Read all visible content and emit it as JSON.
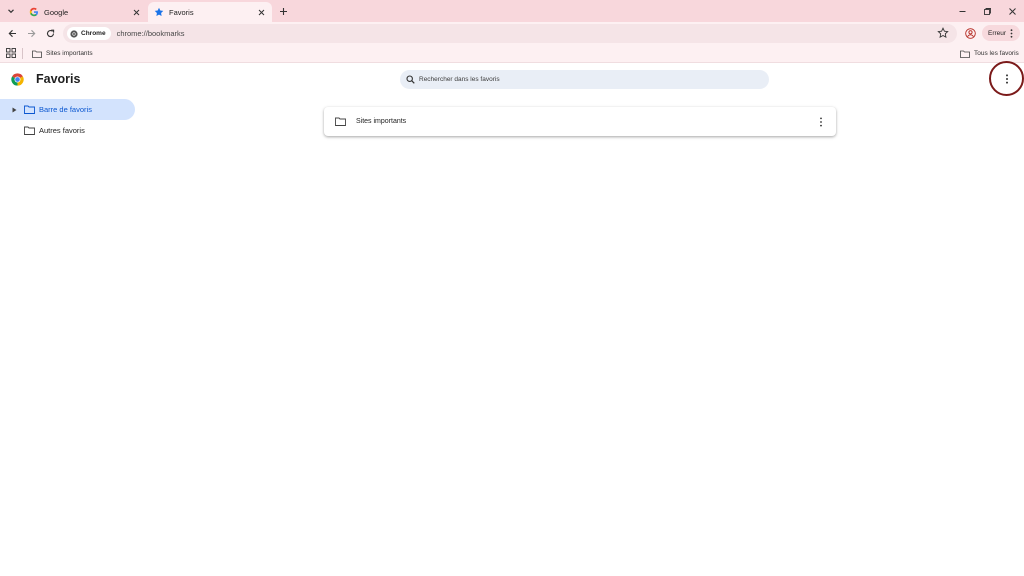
{
  "tabs": [
    {
      "title": "Google",
      "favicon": "google-g-icon",
      "active": false
    },
    {
      "title": "Favoris",
      "favicon": "star-icon",
      "active": true
    }
  ],
  "toolbar": {
    "chip_label": "Chrome",
    "url": "chrome://bookmarks",
    "error_label": "Erreur"
  },
  "bookmark_bar": {
    "items": [
      {
        "label": "Sites importants"
      }
    ],
    "all_bookmarks_label": "Tous les favoris"
  },
  "page": {
    "title": "Favoris",
    "search_placeholder": "Rechercher dans les favoris"
  },
  "sidebar": {
    "items": [
      {
        "label": "Barre de favoris",
        "selected": true
      },
      {
        "label": "Autres favoris",
        "selected": false
      }
    ]
  },
  "content": {
    "folders": [
      {
        "label": "Sites importants"
      }
    ]
  },
  "colors": {
    "tabstrip_bg": "#f8d7dc",
    "toolbar_bg": "#fdf0f2",
    "selected_bg": "#d3e3fd",
    "selected_text": "#0b57d0",
    "highlight_ring": "#7b1a1a"
  }
}
